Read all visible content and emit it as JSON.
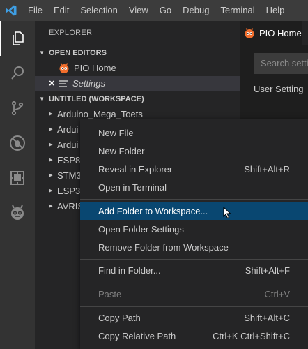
{
  "menubar": [
    "File",
    "Edit",
    "Selection",
    "View",
    "Go",
    "Debug",
    "Terminal",
    "Help"
  ],
  "activity_icons": [
    "explorer-icon",
    "search-icon",
    "source-control-icon",
    "debug-icon",
    "extensions-icon",
    "platformio-icon"
  ],
  "colors": {
    "accent": "#094771",
    "vscode_blue": "#3e9ee3",
    "pio_orange": "#f26e2c"
  },
  "sidebar": {
    "title": "EXPLORER",
    "open_editors": {
      "header": "OPEN EDITORS",
      "items": [
        {
          "label": "PIO Home"
        },
        {
          "close": "×",
          "label": "Settings"
        }
      ]
    },
    "workspace": {
      "header": "UNTITLED (WORKSPACE)",
      "folders": [
        "Arduino_Mega_Toets",
        "Ardui",
        "Ardui",
        "ESP8",
        "STM3",
        "ESP3",
        "AVRIS"
      ]
    }
  },
  "editor": {
    "tab_label": "PIO Home",
    "search_placeholder": "Search setti",
    "user_settings": "User Setting"
  },
  "context_menu": {
    "groups": [
      [
        {
          "label": "New File",
          "kb": ""
        },
        {
          "label": "New Folder",
          "kb": ""
        },
        {
          "label": "Reveal in Explorer",
          "kb": "Shift+Alt+R"
        },
        {
          "label": "Open in Terminal",
          "kb": ""
        }
      ],
      [
        {
          "label": "Add Folder to Workspace...",
          "kb": ""
        },
        {
          "label": "Open Folder Settings",
          "kb": ""
        },
        {
          "label": "Remove Folder from Workspace",
          "kb": ""
        }
      ],
      [
        {
          "label": "Find in Folder...",
          "kb": "Shift+Alt+F"
        }
      ],
      [
        {
          "label": "Paste",
          "kb": "Ctrl+V"
        }
      ],
      [
        {
          "label": "Copy Path",
          "kb": "Shift+Alt+C"
        },
        {
          "label": "Copy Relative Path",
          "kb": "Ctrl+K Ctrl+Shift+C"
        }
      ]
    ]
  }
}
